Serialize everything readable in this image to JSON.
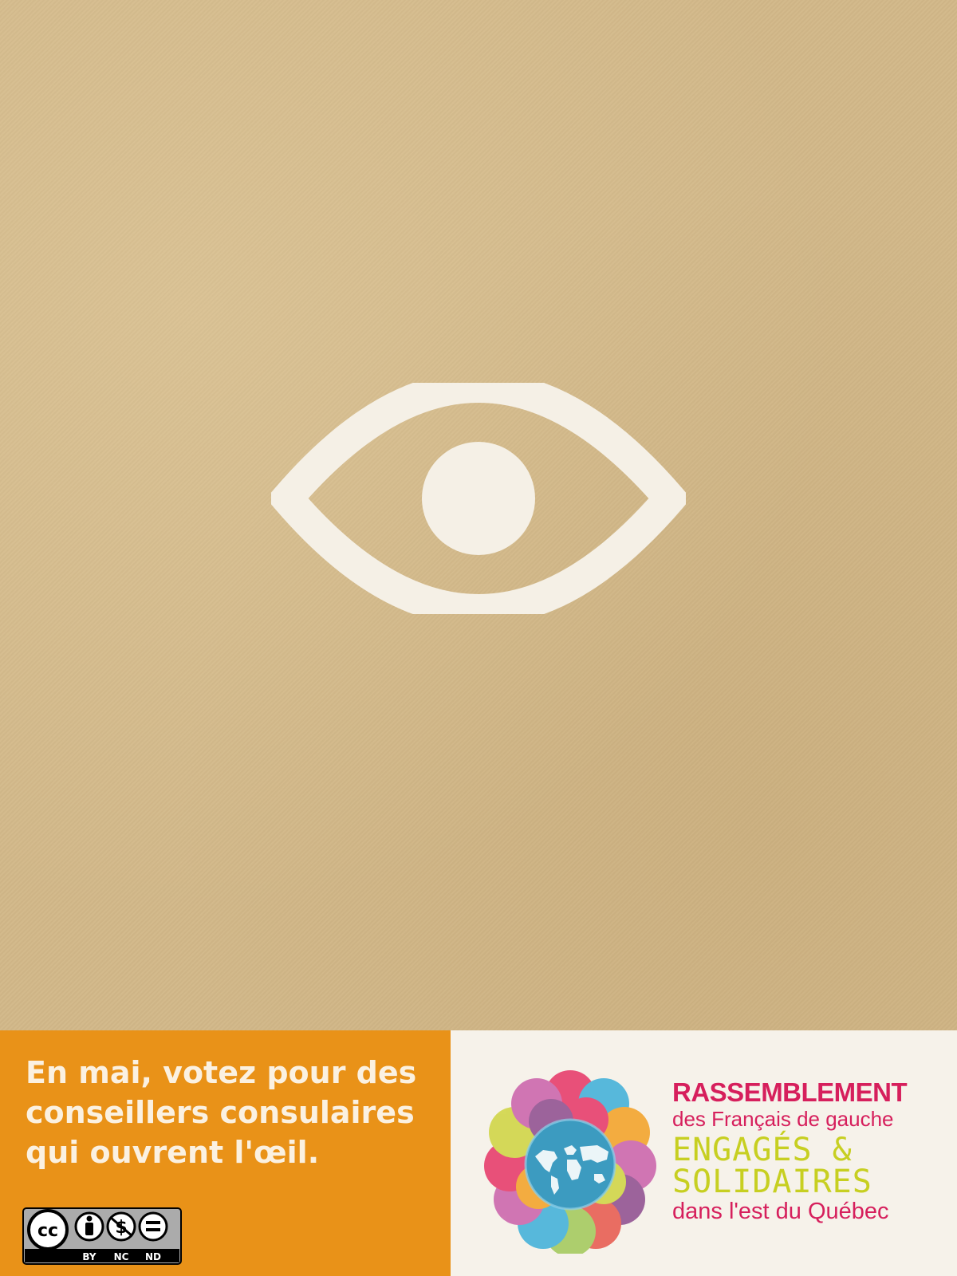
{
  "poster": {
    "background_color": "#d2b889",
    "eye_color": "#f5f0e6",
    "icon": "eye-icon"
  },
  "footer": {
    "left_bg": "#e99218",
    "right_bg": "#f6f2ea",
    "slogan_lines": [
      "En mai, votez pour des",
      "conseillers consulaires",
      "qui ouvrent l'œil."
    ],
    "license": {
      "icon": "creative-commons-badge",
      "labels": [
        "BY",
        "NC",
        "ND"
      ]
    }
  },
  "logo": {
    "icon": "flower-globe-logo",
    "line1": "RASSEMBLEMENT",
    "line2": "des Français de gauche",
    "line3": "ENGAGÉS &",
    "line4": "SOLIDAIRES",
    "line5": "dans l'est du Québec",
    "primary_color": "#d61f5c",
    "secondary_color": "#c7cf21"
  }
}
